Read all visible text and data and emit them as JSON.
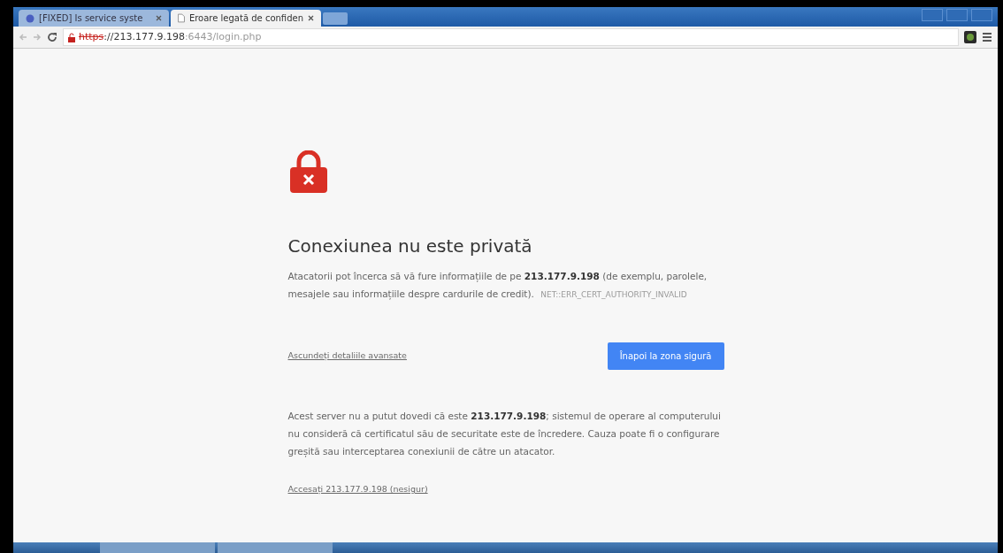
{
  "tabs": [
    {
      "label": "[FIXED] Is service syste",
      "selected": false
    },
    {
      "label": "Eroare legată de confiden",
      "selected": true
    }
  ],
  "address_bar": {
    "scheme": "https",
    "rest": "://213.177.9.198",
    "port_path": ":6443/login.php",
    "insecure": true
  },
  "interstitial": {
    "heading": "Conexiunea nu este privată",
    "message": "Atacatorii pot încerca să vă fure informațiile de pe **213.177.9.198** (de exemplu, parolele, mesajele sau informațiile despre cardurile de credit).",
    "error_code": "NET::ERR_CERT_AUTHORITY_INVALID",
    "details_link": "Ascundeți detaliile avansate",
    "back_button": "Înapoi la zona sigură",
    "details": "Acest server nu a putut dovedi că este **213.177.9.198**; sistemul de operare al computerului nu consideră că certificatul său de securitate este de încredere. Cauza poate fi o configurare greșită sau interceptarea conexiunii de către un atacator.",
    "proceed_link": "Accesați 213.177.9.198 (nesigur)"
  }
}
